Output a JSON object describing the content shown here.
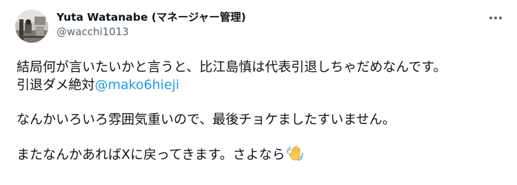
{
  "author": {
    "display_name": "Yuta Watanabe (マネージャー管理)",
    "handle": "@wacchi1013",
    "avatar_icon": "profile-photo-avatar"
  },
  "post": {
    "line1": "結局何が言いたいかと言うと、比江島慎は代表引退しちゃだめなんです。",
    "line2_text": "引退ダメ絶対",
    "line2_mention": "@mako6hieji",
    "line3": "なんかいろいろ雰囲気重いので、最後チョケましたすいません。",
    "line4": "またなんかあればXに戻ってきます。さよなら",
    "line4_emoji": "waving-hand-emoji"
  },
  "more_menu_icon": "more-horizontal-icon",
  "colors": {
    "text": "#0f1419",
    "secondary": "#536471",
    "mention": "#1d9bf0"
  }
}
